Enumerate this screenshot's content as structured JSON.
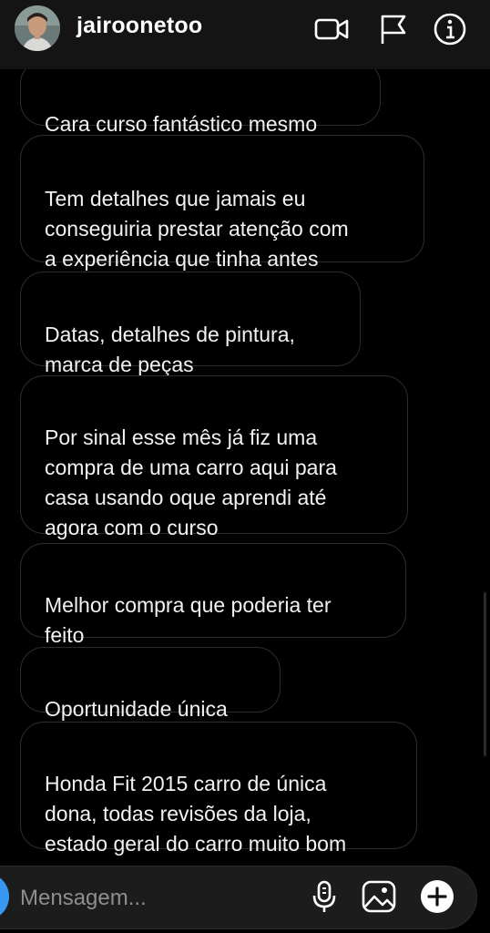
{
  "header": {
    "username": "jairoonetoo",
    "avatar_icon": "profile-photo",
    "video_call_icon": "video-camera-icon",
    "report_icon": "flag-icon",
    "info_icon": "info-icon"
  },
  "messages": [
    {
      "text": "Cara curso fantástico mesmo"
    },
    {
      "text": "Tem detalhes que jamais eu\nconseguiria prestar atenção com\na experiência que tinha antes"
    },
    {
      "text": "Datas, detalhes de pintura,\nmarca de peças"
    },
    {
      "text": "Por sinal esse mês já fiz uma\ncompra de uma carro aqui para\ncasa usando oque aprendi até\nagora com o curso"
    },
    {
      "text": "Melhor compra que poderia ter\nfeito"
    },
    {
      "text": "Oportunidade única"
    },
    {
      "text": "Honda Fit 2015 carro de única\ndona, todas revisões da loja,\nestado geral do carro muito bom"
    }
  ],
  "composer": {
    "placeholder": "Mensagem...",
    "camera_icon": "camera-icon",
    "mic_icon": "microphone-icon",
    "gallery_icon": "image-icon",
    "add_icon": "plus-circle-icon"
  },
  "colors": {
    "background": "#000000",
    "header": "#141414",
    "bubble_border": "#2c2c2c",
    "accent_blue": "#3897f0"
  }
}
